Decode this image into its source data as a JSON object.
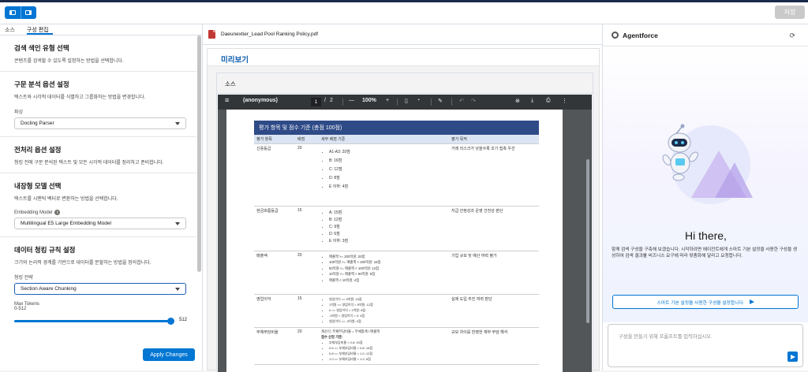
{
  "topbar": {
    "save_label": "저장"
  },
  "left_tabs": [
    {
      "label": "소스"
    },
    {
      "label": "구성 편집"
    }
  ],
  "sections": {
    "index_type": {
      "title": "검색 색인 유형 선택",
      "desc": "콘텐츠를 검색할 수 있도록 설정하는 방법을 선택합니다."
    },
    "parse": {
      "title": "구문 분석 옵션 설정",
      "desc": "텍스트와 시각적 데이터를 식별하고 그룹화하는 방법을 변경합니다.",
      "field_label": "파싱",
      "value": "Docling Parser"
    },
    "preprocess": {
      "title": "전처리 옵션 설정",
      "desc": "청킹 전에 구문 분석된 텍스트 및 모든 시각적 데이터를 정리하고 준비합니다."
    },
    "embedding": {
      "title": "내장형 모델 선택",
      "desc": "텍스트를 시맨틱 벡터로 변환하는 방법을 선택합니다.",
      "field_label": "Embedding Model",
      "value": "Multilingual E5 Large Embedding Model"
    },
    "chunking": {
      "title": "데이터 청킹 규칙 설정",
      "desc": "크기와 논리적 경계를 기반으로 데이터를 분할하는 방법을 정의합니다.",
      "field_label": "청킹 전략",
      "value": "Section Aware Chunking",
      "max_tokens_label": "Max Tokens",
      "range_label": "0-512",
      "max_tokens_value": "512"
    }
  },
  "apply_label": "Apply Changes",
  "middle": {
    "file_name": "Daeunextier_Lead Pool Ranking Policy.pdf",
    "preview_title": "미리보기",
    "source_label": "소스"
  },
  "viewer": {
    "menu_glyph": "≡",
    "doc_name": "(anonymous)",
    "page_current": "1",
    "page_sep": "/",
    "page_total": "2",
    "zoom_out": "—",
    "zoom": "100%",
    "zoom_in": "+",
    "tool_glyphs": [
      "▯",
      "◔",
      "✎",
      "↶",
      "↷",
      "⊛",
      "⤓",
      "⎙",
      "⋮"
    ]
  },
  "pdf_table": {
    "title": "평가 항목 및 점수 기준 (총점 100점)",
    "headers": [
      "평가 항목",
      "배점",
      "세부 배점 기준",
      "평가 목적"
    ],
    "rows": [
      {
        "item": "신용등급",
        "weight": "20",
        "criteria": [
          "A1-A3: 20점",
          "B: 16점",
          "C: 12점",
          "D: 8점",
          "E 이하: 4점"
        ],
        "purpose": "거래 리스크가 낮을수록 조기 접촉 우선"
      },
      {
        "item": "현금흐름등급",
        "weight": "15",
        "criteria": [
          "A: 15점",
          "B: 12점",
          "C: 9점",
          "D: 6점",
          "E 이하: 3점"
        ],
        "purpose": "지급 안정성과 운영 건전성 판단"
      },
      {
        "item": "매출액",
        "weight": "20",
        "criteria": [
          "매출액 >= 200억원: 20점",
          "100억원 <= 매출액 < 200억원: 16점",
          "50억원 <= 매출액 < 100억원: 12점",
          "10억원 <= 매출액 < 50억원: 8점",
          "매출액 < 10억원: 4점"
        ],
        "purpose": "기업 규모 및 예산 여력 평가"
      },
      {
        "item": "영업이익",
        "weight": "15",
        "criteria": [
          "영업이익 >= 5억원: 15점",
          "1억원 <= 영업이익 < 5억원: 12점",
          "0 <= 영업이익 < 1억원: 8점",
          "-3억원 < 영업이익 < 0: 4점",
          "영업이익 <= -3억원: 0점"
        ],
        "purpose": "실제 도입 추진 여력 판단"
      },
      {
        "item": "부채부담비율",
        "weight": "20",
        "criteria_head": [
          "계산식: 부채부담비율 = 부채총계 / 매출액",
          "점수 산정 기준:"
        ],
        "criteria": [
          "부채부담비율 < 0.6: 20점",
          "0.6 <= 부채부담비율 < 0.8: 16점",
          "0.8 <= 부채부담비율 < 1.0: 12점",
          "1.0 <= 부채부담비율 < 1.2: 8점"
        ],
        "purpose": "규모 차이를 반영한 재무 부담 해석"
      }
    ]
  },
  "agent": {
    "title": "Agentforce",
    "greeting": "Hi there,",
    "description": "함께 검색 구성을 구축해 보겠습니다. 시작하려면 에이전트에게 스마트 기본 설정을 사용한 구성을 생성하여 검색 결과를 비즈니스 요구에 따라 맞춤화해 달라고 요청합니다.",
    "start_button": "스마트 기본 설정을 사용한 구성을 설정합니다.",
    "composer_placeholder": "구성을 만들기 위해 프롬프트를 입력하십시오."
  },
  "colors": {
    "brand": "#0176d3",
    "table_header": "#2e4a87",
    "viewer_bar": "#323639"
  },
  "icons": [
    "panel-left-icon",
    "panel-right-icon",
    "pdf-file-icon",
    "info-icon",
    "chevron-down-icon",
    "menu-icon",
    "download-icon",
    "print-icon",
    "refresh-icon",
    "send-icon",
    "robot-icon"
  ]
}
